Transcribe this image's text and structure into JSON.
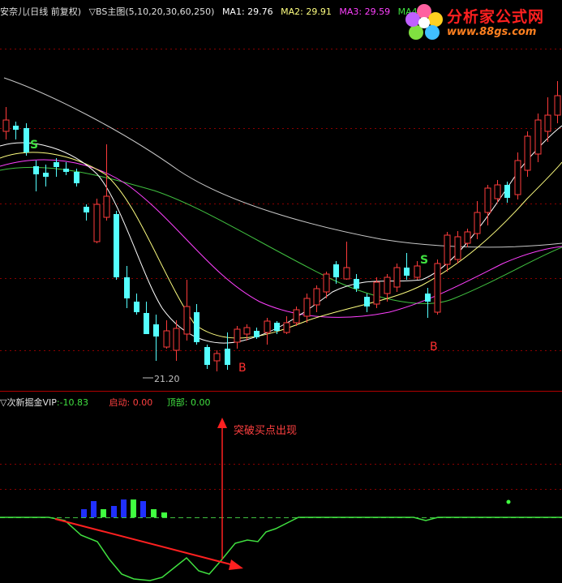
{
  "main_header": {
    "stock": "安奈儿(日线 前复权)",
    "indicator": "▽BS主图(5,10,20,30,60,250)",
    "ma1_label": "MA1: 29.76",
    "ma2_label": "MA2: 29.91",
    "ma3_label": "MA3: 29.59",
    "ma4_label": "MA4"
  },
  "sub_header": {
    "indicator": "▽次新掘金VIP",
    "value": ":-10.83",
    "start_label": "启动: 0.00",
    "top_label": "顶部: 0.00"
  },
  "watermark": {
    "brand": "分析家公式网",
    "url": "www.88gs.com"
  },
  "annotations": {
    "low_price": "21.20",
    "buy_signal": "B",
    "sell_signal": "S",
    "breakout_text": "突破买点出现"
  },
  "colors": {
    "up_candle": "#ff3b3b",
    "down_candle": "#54ffff",
    "ma1": "#ffffff",
    "ma2": "#ffff80",
    "ma3": "#ff40ff",
    "ma4": "#40c040",
    "ma_long": "#c8c8c8",
    "osc_line": "#40e040",
    "bar_blue": "#2030ff",
    "bar_green": "#40ff40",
    "arrow": "#ff2020",
    "grid": "#8b0000"
  }
}
